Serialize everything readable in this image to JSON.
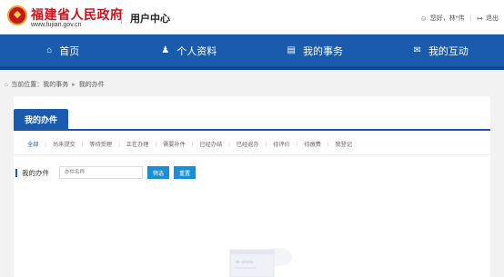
{
  "header": {
    "site_title": "福建省人民政府",
    "site_url": "www.fujian.gov.cn",
    "user_center": "用户中心",
    "greeting": "您好，林*伟",
    "logout": "退出"
  },
  "nav": {
    "items": [
      {
        "label": "首页",
        "icon": "home-icon"
      },
      {
        "label": "个人资料",
        "icon": "person-icon"
      },
      {
        "label": "我的事务",
        "icon": "document-icon"
      },
      {
        "label": "我的互动",
        "icon": "chat-icon"
      }
    ]
  },
  "breadcrumb": {
    "prefix": "当前位置：",
    "items": [
      "我的事务",
      "我的办件"
    ]
  },
  "card": {
    "tab": "我的办件",
    "filters": [
      "全部",
      "尚未提交",
      "等待受理",
      "正在办理",
      "需要补件",
      "已经办结",
      "已经退办",
      "待评价",
      "待缴费",
      "我登记"
    ],
    "active_filter": 0,
    "search_label": "我的办件",
    "search_placeholder": "办件名称",
    "filter_button": "筛选",
    "reset_button": "重置"
  },
  "colors": {
    "brand_red": "#c8161d",
    "nav_blue": "#1a5bae",
    "button_blue": "#1a8fd6"
  }
}
